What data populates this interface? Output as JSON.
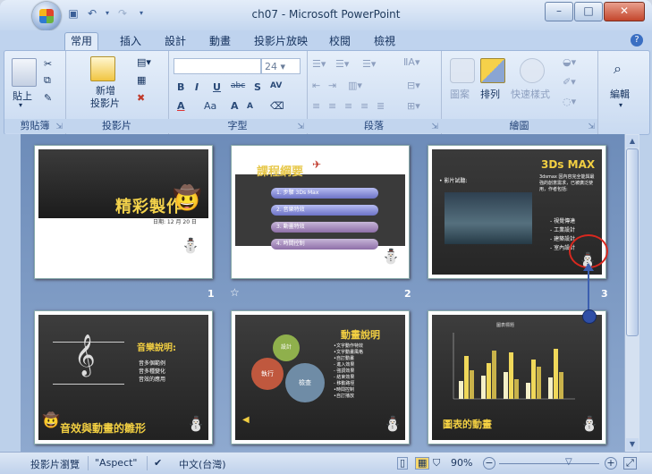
{
  "window": {
    "title": "ch07 - Microsoft PowerPoint"
  },
  "tabs": [
    "常用",
    "插入",
    "設計",
    "動畫",
    "投影片放映",
    "校閱",
    "檢視"
  ],
  "ribbon": {
    "groups": [
      "剪貼簿",
      "投影片",
      "字型",
      "段落",
      "繪圖",
      "編輯"
    ],
    "clipboard": {
      "paste": "貼上"
    },
    "slides": {
      "new_slide_1": "新增",
      "new_slide_2": "投影片"
    },
    "font": {
      "font_size": "24",
      "bold": "B",
      "italic": "I",
      "underline": "U",
      "strike": "abc",
      "shadow": "S",
      "spacing": "AV",
      "color": "A",
      "case": "Aa",
      "grow": "A",
      "shrink": "A"
    },
    "drawing": {
      "shapes": "圖案",
      "arrange": "排列",
      "quick_styles": "快速樣式"
    },
    "editing": {
      "label": "編輯"
    }
  },
  "slides": [
    {
      "number": "1",
      "title": "精彩製作",
      "date": "日期: 12 月 20 日"
    },
    {
      "number": "2",
      "title": "課程綱要",
      "items": [
        "1. 步驟 3Ds Max",
        "2. 音樂特效",
        "3. 動畫特效",
        "4. 時間控制"
      ]
    },
    {
      "number": "3",
      "title": "3Ds MAX",
      "bullet": "• 影片試聽:",
      "desc": "3dsmax 因內容完全能與最強的創意需求，已被廣泛使用，作者包括:",
      "points": [
        "- 視覺傳達",
        "- 工業設計",
        "- 建築設計",
        "- 室內設計"
      ]
    },
    {
      "number": "4",
      "title": "音樂說明:",
      "caption": "音效與動畫的雛形",
      "notes": [
        "音多個範例",
        "音多種變化",
        "音效的應用"
      ]
    },
    {
      "number": "5",
      "title": "動畫說明",
      "gear_labels": [
        "執行",
        "設計",
        "檢查"
      ],
      "items": [
        "•文字動作特效",
        "•文字動畫風格",
        "•自訂動畫",
        "- 進入效果",
        "- 強調效果",
        "- 結束效果",
        "- 移動路徑",
        "•時間控制",
        "•自訂播放"
      ]
    },
    {
      "number": "6",
      "title": "圖表的動畫",
      "chart_title": "圖表標題"
    }
  ],
  "status": {
    "view": "投影片瀏覽",
    "theme": "\"Aspect\"",
    "lang": "中文(台灣)",
    "zoom": "90%"
  },
  "colors": {
    "accent": "#d8281f",
    "ribbon": "#dfeaf8",
    "sorter_bg": "#7894bf"
  }
}
